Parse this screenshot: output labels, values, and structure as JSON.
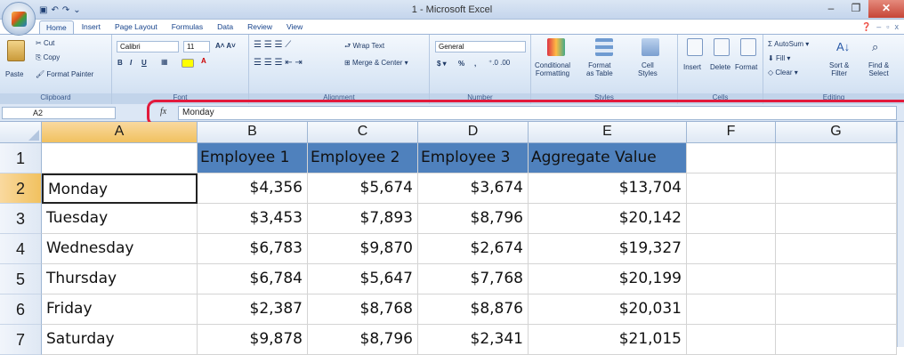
{
  "titlebar": {
    "title": "1 - Microsoft Excel",
    "qat": [
      "save-icon",
      "undo-icon",
      "redo-icon",
      "customize-icon"
    ]
  },
  "tabs": [
    "Home",
    "Insert",
    "Page Layout",
    "Formulas",
    "Data",
    "Review",
    "View"
  ],
  "ribbon": {
    "clipboard": {
      "paste": "Paste",
      "cut": "Cut",
      "copy": "Copy",
      "format_painter": "Format Painter",
      "label": "Clipboard"
    },
    "font": {
      "name": "Calibri",
      "size": "11",
      "label": "Font"
    },
    "alignment": {
      "wrap_text": "Wrap Text",
      "merge_center": "Merge & Center",
      "label": "Alignment"
    },
    "number": {
      "format": "General",
      "currency": "$",
      "percent": "%",
      "comma": ",",
      "label": "Number"
    },
    "styles": {
      "conditional": "Conditional",
      "conditional2": "Formatting",
      "format_as": "Format",
      "format_as2": "as Table",
      "cell": "Cell",
      "cell2": "Styles",
      "label": "Styles"
    },
    "cells": {
      "insert": "Insert",
      "delete": "Delete",
      "format": "Format",
      "label": "Cells"
    },
    "editing": {
      "autosum": "AutoSum",
      "fill": "Fill",
      "clear": "Clear",
      "sort": "Sort &",
      "sort2": "Filter",
      "find": "Find &",
      "find2": "Select",
      "label": "Editing"
    }
  },
  "namebox": "A2",
  "formula": "Monday",
  "columns": [
    "A",
    "B",
    "C",
    "D",
    "E",
    "F",
    "G"
  ],
  "rows": [
    "1",
    "2",
    "3",
    "4",
    "5",
    "6",
    "7"
  ],
  "sheet": {
    "headers": [
      "",
      "Employee 1",
      "Employee 2",
      "Employee 3",
      "Aggregate Value"
    ],
    "data": [
      [
        "Monday",
        "$4,356",
        "$5,674",
        "$3,674",
        "$13,704"
      ],
      [
        "Tuesday",
        "$3,453",
        "$7,893",
        "$8,796",
        "$20,142"
      ],
      [
        "Wednesday",
        "$6,783",
        "$9,870",
        "$2,674",
        "$19,327"
      ],
      [
        "Thursday",
        "$6,784",
        "$5,647",
        "$7,768",
        "$20,199"
      ],
      [
        "Friday",
        "$2,387",
        "$8,768",
        "$8,876",
        "$20,031"
      ],
      [
        "Saturday",
        "$9,878",
        "$8,796",
        "$2,341",
        "$21,015"
      ]
    ]
  },
  "colors": {
    "header_fill": "#4f81bd",
    "highlight": "#e21a3c"
  }
}
